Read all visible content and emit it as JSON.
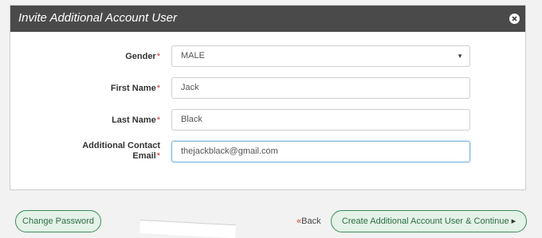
{
  "modal": {
    "title": "Invite Additional Account User",
    "close_icon": "close-icon"
  },
  "form": {
    "gender": {
      "label": "Gender",
      "required_mark": "*",
      "value": "MALE",
      "arrow": "▼"
    },
    "first_name": {
      "label": "First Name",
      "required_mark": "*",
      "value": "Jack"
    },
    "last_name": {
      "label": "Last Name",
      "required_mark": "*",
      "value": "Black"
    },
    "email": {
      "label_line1": "Additional Contact",
      "label_line2": "Email",
      "required_mark": "*",
      "value": "thejackblack@gmail.com"
    }
  },
  "footer": {
    "change_password": "Change Password",
    "back_chevrons": "«",
    "back": "Back",
    "continue": "Create Additional Account User & Continue",
    "continue_arrow": "▸"
  },
  "colors": {
    "header_bg": "#4a4a4a",
    "button_border": "#3d8a5b",
    "button_bg": "#e4f2e7",
    "required": "#c0392b",
    "focus_border": "#7fb6e0"
  }
}
